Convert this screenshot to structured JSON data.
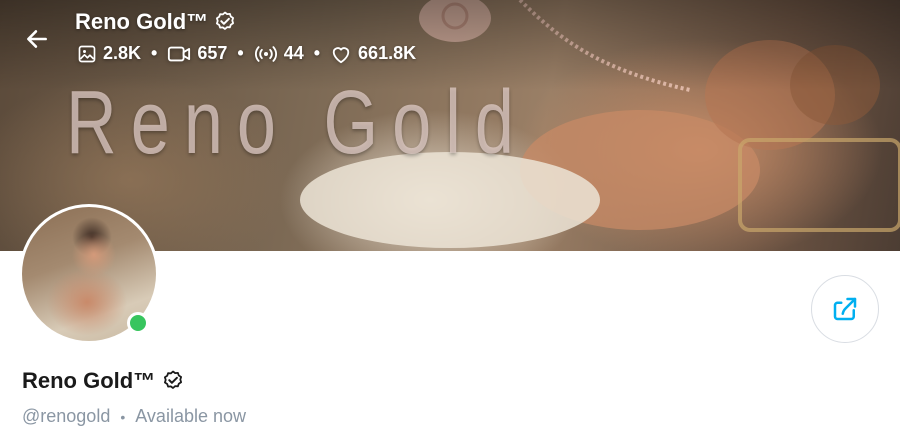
{
  "header": {
    "back_icon": "arrow-left-icon",
    "name": "Reno Gold™",
    "verified_icon": "verified-badge-icon",
    "stats": [
      {
        "icon": "image-icon",
        "value": "2.8K"
      },
      {
        "icon": "video-icon",
        "value": "657"
      },
      {
        "icon": "stream-icon",
        "value": "44"
      },
      {
        "icon": "heart-icon",
        "value": "661.8K"
      }
    ]
  },
  "cover": {
    "title_text": "Reno Gold"
  },
  "profile": {
    "name": "Reno Gold™",
    "handle": "@renogold",
    "status": "Available now",
    "online": true,
    "online_color": "#37c55e"
  },
  "actions": {
    "share_icon": "share-icon",
    "accent_color": "#00aff0"
  }
}
